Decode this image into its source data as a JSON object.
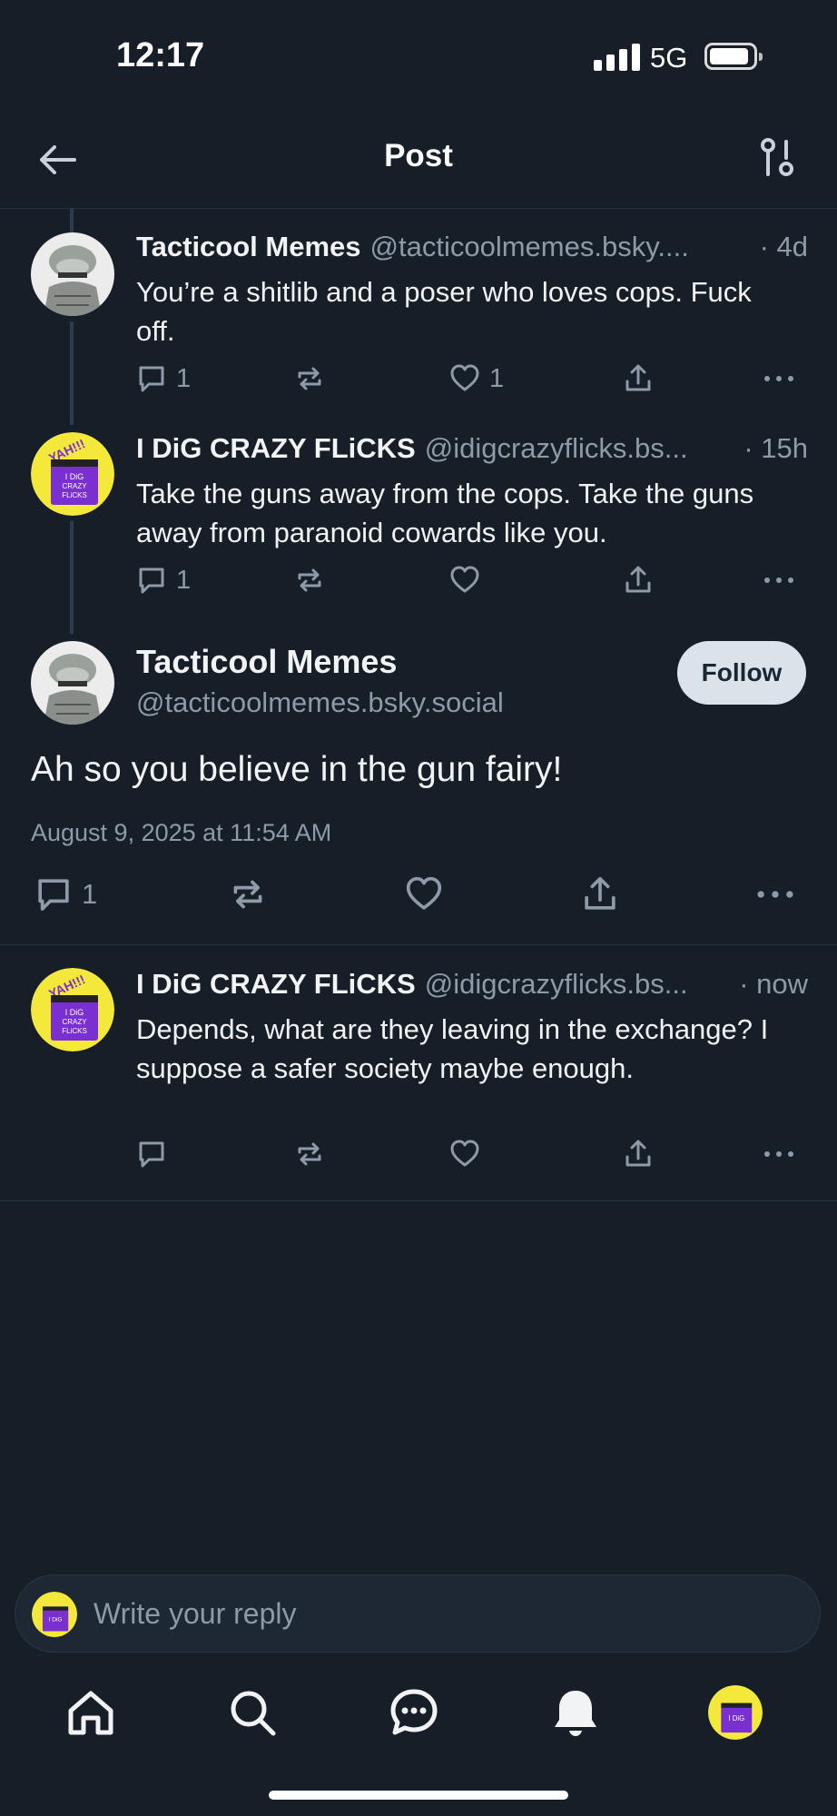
{
  "status_bar": {
    "time": "12:17",
    "network": "5G"
  },
  "header": {
    "title": "Post",
    "back_icon": "arrow-left-icon",
    "settings_icon": "sliders-icon"
  },
  "colors": {
    "background": "#161e27",
    "secondary_text": "#8e9aa8",
    "follow_bg": "#dbe3ea"
  },
  "thread": [
    {
      "author_name": "Tacticool Memes",
      "author_handle": "@tacticoolmemes.bsky....",
      "time": "· 4d",
      "text": "You’re a shitlib and a poser who loves cops. Fuck off.",
      "reply_count": "1",
      "like_count": "1"
    },
    {
      "author_name": "I DiG CRAZY FLiCKS",
      "author_handle": "@idigcrazyflicks.bs...",
      "time": "· 15h",
      "text": "Take the guns away from the cops. Take the guns away from paranoid cowards like you.",
      "reply_count": "1",
      "like_count": ""
    }
  ],
  "main_post": {
    "author_name": "Tacticool Memes",
    "author_handle": "@tacticoolmemes.bsky.social",
    "follow_label": "Follow",
    "text": "Ah so you believe in the gun fairy!",
    "date": "August 9, 2025 at 11:54 AM",
    "reply_count": "1"
  },
  "replies": [
    {
      "author_name": "I DiG CRAZY FLiCKS",
      "author_handle": "@idigcrazyflicks.bs...",
      "time": "· now",
      "text": "Depends, what are they leaving in the exchange? I suppose a safer society maybe enough."
    }
  ],
  "reply_box": {
    "placeholder": "Write your reply"
  },
  "avatar_text": {
    "line1": "YAH!!!",
    "line2": "I DiG",
    "line3": "CRAZY",
    "line4": "FLiCKS"
  },
  "tabbar": [
    "home-icon",
    "search-icon",
    "chat-icon",
    "bell-icon",
    "profile-avatar"
  ]
}
